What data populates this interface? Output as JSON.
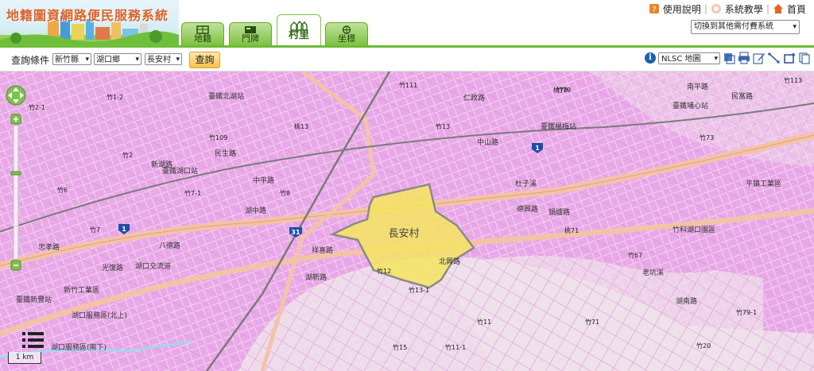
{
  "header": {
    "app_title": "地籍圖資網路便民服務系統",
    "tabs": [
      {
        "label": "地籍",
        "icon": "cadastral-icon",
        "active": false
      },
      {
        "label": "門牌",
        "icon": "doorplate-icon",
        "active": false
      },
      {
        "label": "村里",
        "icon": "village-icon",
        "active": true
      },
      {
        "label": "坐標",
        "icon": "coordinate-icon",
        "active": false
      }
    ],
    "links": {
      "help": "使用說明",
      "tutorial": "系統教學",
      "home": "首頁"
    },
    "system_switch": "切換到其他需付費系統"
  },
  "query": {
    "label": "查詢條件",
    "county": "新竹縣",
    "township": "湖口鄉",
    "village": "長安村",
    "submit": "查詢"
  },
  "toolbar": {
    "basemap": "NLSC 地圖",
    "tools": [
      "layers-icon",
      "print-icon",
      "edit-icon",
      "measure-icon",
      "area-icon",
      "export-icon"
    ]
  },
  "map": {
    "selected_area_label": "長安村",
    "scale": "1 km",
    "colors": {
      "land": "#e9a9e8",
      "highlight": "#f5e55f",
      "highlight_border": "#8a8a8a",
      "road": "#f3c3a7",
      "rail": "#7a7a7a",
      "river": "#9ed8f0"
    },
    "labels": [
      {
        "text": "湖口交流道"
      },
      {
        "text": "中山路"
      },
      {
        "text": "新湖路"
      },
      {
        "text": "民生路"
      },
      {
        "text": "中平路"
      },
      {
        "text": "湖中路"
      },
      {
        "text": "八德路"
      },
      {
        "text": "光復路"
      },
      {
        "text": "忠孝路"
      },
      {
        "text": "湖新路"
      },
      {
        "text": "祥喜路"
      },
      {
        "text": "北興路"
      },
      {
        "text": "德興路"
      },
      {
        "text": "仁政路"
      },
      {
        "text": "新竹工業區"
      },
      {
        "text": "湖口服務區(北上)"
      },
      {
        "text": "湖口服務區(南下)"
      },
      {
        "text": "臺鐵湖口站"
      },
      {
        "text": "臺鐵北湖站"
      },
      {
        "text": "臺鐵新豐站"
      },
      {
        "text": "臺鐵楊梅站"
      },
      {
        "text": "臺鐵埔心站"
      },
      {
        "text": "竹科湖口園區"
      },
      {
        "text": "平鎮工業區"
      },
      {
        "text": "民富路"
      },
      {
        "text": "南平路"
      },
      {
        "text": "杜子溪"
      },
      {
        "text": "老坑溪"
      },
      {
        "text": "湖南路"
      },
      {
        "text": "鍋爐路"
      }
    ],
    "route_shields": [
      {
        "text": "1"
      },
      {
        "text": "31"
      },
      {
        "text": "1"
      }
    ],
    "route_numbers": [
      {
        "text": "竹1-2"
      },
      {
        "text": "竹2-1"
      },
      {
        "text": "竹109"
      },
      {
        "text": "竹2"
      },
      {
        "text": "竹6"
      },
      {
        "text": "竹7-1"
      },
      {
        "text": "竹8"
      },
      {
        "text": "竹7"
      },
      {
        "text": "竹13"
      },
      {
        "text": "竹12"
      },
      {
        "text": "竹13-1"
      },
      {
        "text": "竹11"
      },
      {
        "text": "竹15"
      },
      {
        "text": "竹11-1"
      },
      {
        "text": "竹71"
      },
      {
        "text": "竹67"
      },
      {
        "text": "竹73"
      },
      {
        "text": "竹79"
      },
      {
        "text": "竹111"
      },
      {
        "text": "竹113"
      },
      {
        "text": "竹20"
      },
      {
        "text": "竹79-1"
      },
      {
        "text": "桃13"
      },
      {
        "text": "桃79"
      },
      {
        "text": "桃71"
      }
    ]
  }
}
